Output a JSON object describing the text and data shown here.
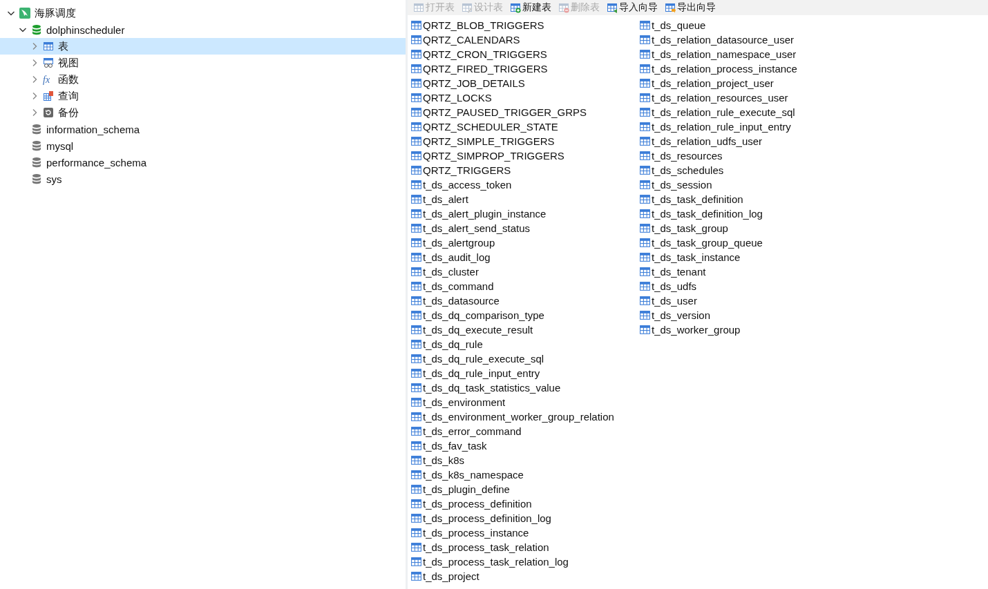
{
  "tree": [
    {
      "label": "海豚调度",
      "kind": "connection",
      "expanded": true,
      "selected": false,
      "children": [
        {
          "label": "dolphinscheduler",
          "kind": "database",
          "expanded": true,
          "selected": false,
          "children": [
            {
              "label": "表",
              "kind": "tables",
              "expanded": false,
              "selected": true
            },
            {
              "label": "视图",
              "kind": "views",
              "expanded": false,
              "selected": false
            },
            {
              "label": "函数",
              "kind": "functions",
              "icon_text": "fx",
              "expanded": false,
              "selected": false
            },
            {
              "label": "查询",
              "kind": "queries",
              "expanded": false,
              "selected": false
            },
            {
              "label": "备份",
              "kind": "backups",
              "expanded": false,
              "selected": false
            }
          ]
        },
        {
          "label": "information_schema",
          "kind": "database-closed",
          "selected": false
        },
        {
          "label": "mysql",
          "kind": "database-closed",
          "selected": false
        },
        {
          "label": "performance_schema",
          "kind": "database-closed",
          "selected": false
        },
        {
          "label": "sys",
          "kind": "database-closed",
          "selected": false
        }
      ]
    }
  ],
  "toolbar": [
    {
      "label": "打开表",
      "kind": "open",
      "disabled": true
    },
    {
      "label": "设计表",
      "kind": "design",
      "disabled": true
    },
    {
      "label": "新建表",
      "kind": "new",
      "disabled": false
    },
    {
      "label": "删除表",
      "kind": "delete",
      "disabled": true
    },
    {
      "label": "导入向导",
      "kind": "import",
      "disabled": false
    },
    {
      "label": "导出向导",
      "kind": "export",
      "disabled": false
    }
  ],
  "tables": [
    "QRTZ_BLOB_TRIGGERS",
    "QRTZ_CALENDARS",
    "QRTZ_CRON_TRIGGERS",
    "QRTZ_FIRED_TRIGGERS",
    "QRTZ_JOB_DETAILS",
    "QRTZ_LOCKS",
    "QRTZ_PAUSED_TRIGGER_GRPS",
    "QRTZ_SCHEDULER_STATE",
    "QRTZ_SIMPLE_TRIGGERS",
    "QRTZ_SIMPROP_TRIGGERS",
    "QRTZ_TRIGGERS",
    "t_ds_access_token",
    "t_ds_alert",
    "t_ds_alert_plugin_instance",
    "t_ds_alert_send_status",
    "t_ds_alertgroup",
    "t_ds_audit_log",
    "t_ds_cluster",
    "t_ds_command",
    "t_ds_datasource",
    "t_ds_dq_comparison_type",
    "t_ds_dq_execute_result",
    "t_ds_dq_rule",
    "t_ds_dq_rule_execute_sql",
    "t_ds_dq_rule_input_entry",
    "t_ds_dq_task_statistics_value",
    "t_ds_environment",
    "t_ds_environment_worker_group_relation",
    "t_ds_error_command",
    "t_ds_fav_task",
    "t_ds_k8s",
    "t_ds_k8s_namespace",
    "t_ds_plugin_define",
    "t_ds_process_definition",
    "t_ds_process_definition_log",
    "t_ds_process_instance",
    "t_ds_process_task_relation",
    "t_ds_process_task_relation_log",
    "t_ds_project",
    "t_ds_queue",
    "t_ds_relation_datasource_user",
    "t_ds_relation_namespace_user",
    "t_ds_relation_process_instance",
    "t_ds_relation_project_user",
    "t_ds_relation_resources_user",
    "t_ds_relation_rule_execute_sql",
    "t_ds_relation_rule_input_entry",
    "t_ds_relation_udfs_user",
    "t_ds_resources",
    "t_ds_schedules",
    "t_ds_session",
    "t_ds_task_definition",
    "t_ds_task_definition_log",
    "t_ds_task_group",
    "t_ds_task_group_queue",
    "t_ds_task_instance",
    "t_ds_tenant",
    "t_ds_udfs",
    "t_ds_user",
    "t_ds_version",
    "t_ds_worker_group"
  ]
}
